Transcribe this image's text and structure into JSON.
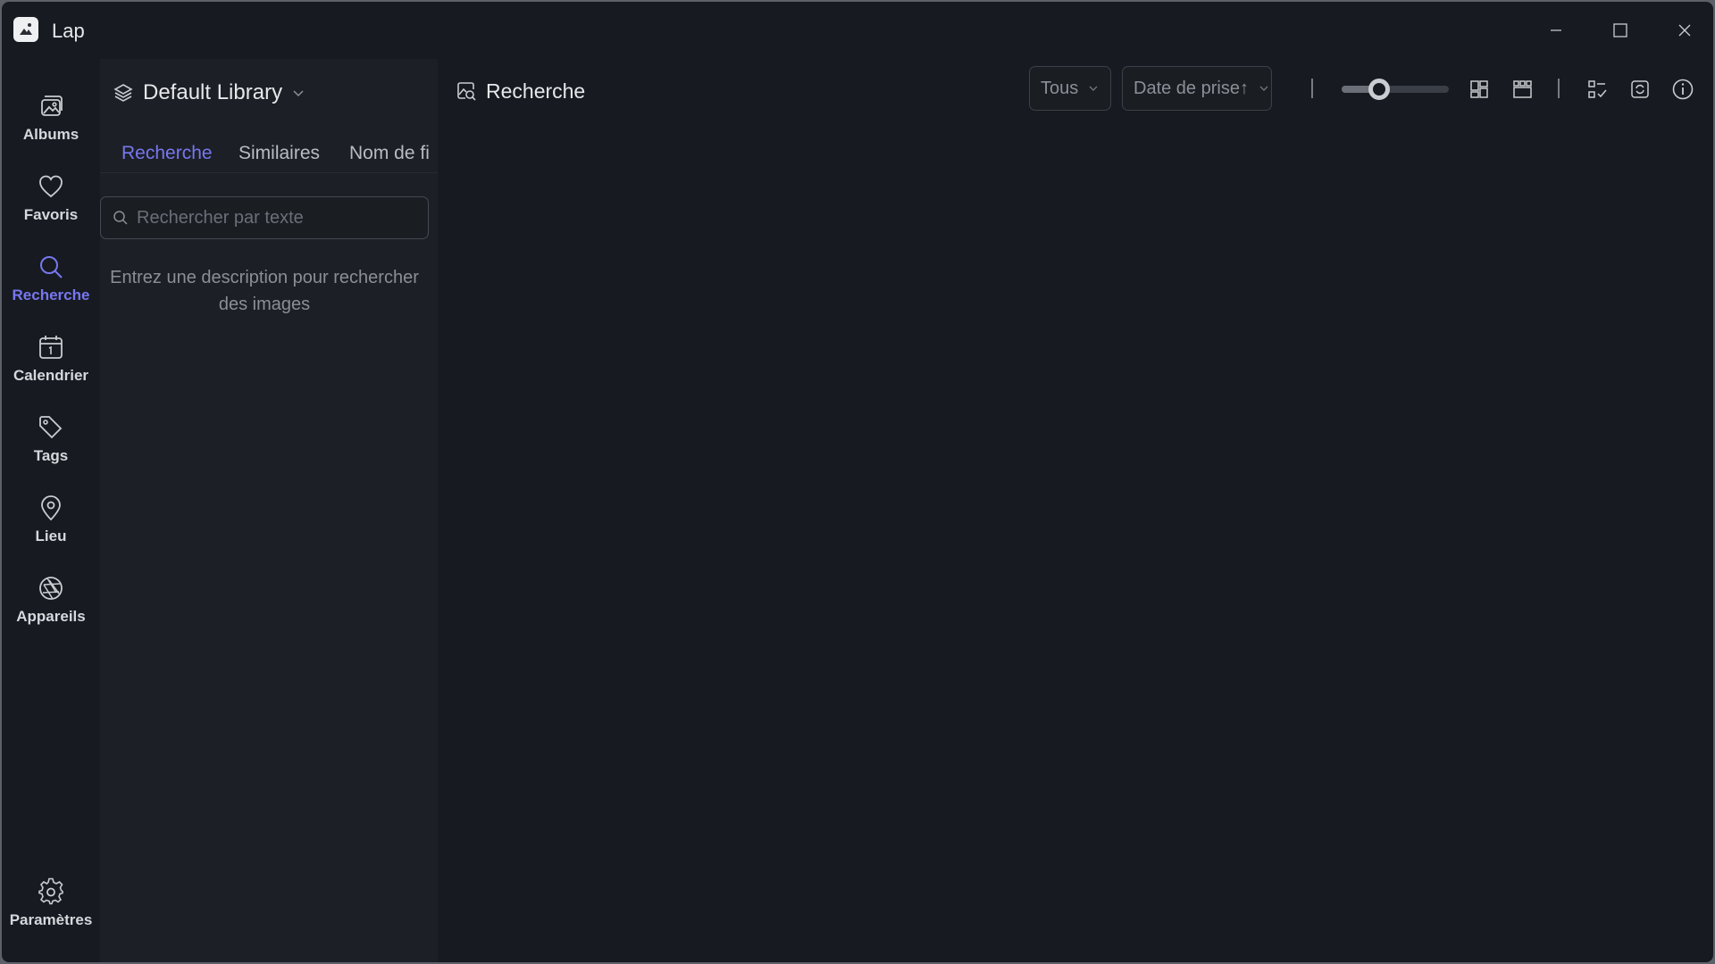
{
  "app": {
    "title": "Lap"
  },
  "rail": {
    "items": [
      {
        "label": "Albums",
        "icon": "albums-icon",
        "active": false
      },
      {
        "label": "Favoris",
        "icon": "heart-icon",
        "active": false
      },
      {
        "label": "Recherche",
        "icon": "search-icon",
        "active": true
      },
      {
        "label": "Calendrier",
        "icon": "calendar-icon",
        "active": false
      },
      {
        "label": "Tags",
        "icon": "tag-icon",
        "active": false
      },
      {
        "label": "Lieu",
        "icon": "location-pin-icon",
        "active": false
      },
      {
        "label": "Appareils",
        "icon": "camera-aperture-icon",
        "active": false
      }
    ],
    "settings_label": "Paramètres"
  },
  "panel": {
    "library": "Default Library",
    "tabs": [
      {
        "label": "Recherche",
        "active": true
      },
      {
        "label": "Similaires",
        "active": false
      },
      {
        "label": "Nom de fi",
        "active": false
      }
    ],
    "search_placeholder": "Rechercher par texte",
    "hint": "Entrez une description pour rechercher des images"
  },
  "main": {
    "title": "Recherche",
    "filter_type": "Tous",
    "sort_by": "Date de prise↑",
    "thumbnail_size": 0.35
  },
  "colors": {
    "accent": "#7777f0",
    "background": "#171a20",
    "panel": "#1c1f25"
  }
}
